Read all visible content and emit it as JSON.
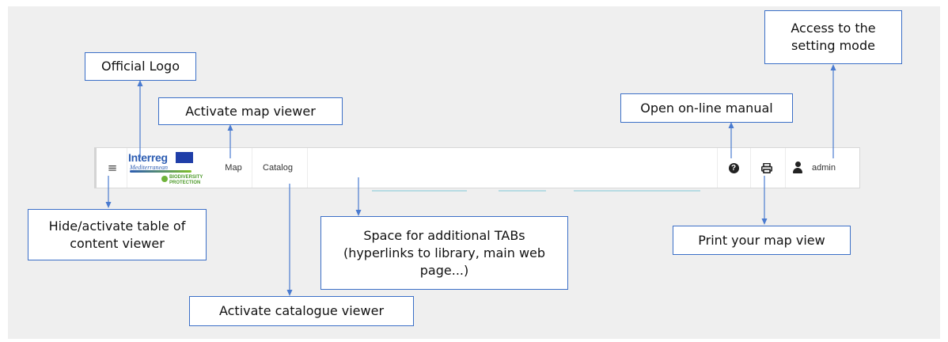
{
  "callouts": {
    "official_logo": "Official Logo",
    "activate_map": "Activate map viewer",
    "online_manual": "Open on-line manual",
    "setting_mode": "Access to the\nsetting mode",
    "hide_toc": "Hide/activate table of\ncontent viewer",
    "additional_tabs": "Space for additional TABs\n(hyperlinks to library, main web\npage...)",
    "print_view": "Print your map view",
    "catalogue": "Activate catalogue viewer"
  },
  "toolbar": {
    "menu_icon": "hamburger-icon",
    "logo": {
      "line1": "Interreg",
      "line2": "Mediterranean",
      "tagline": "BIODIVERSITY\nPROTECTION"
    },
    "tabs": [
      "Map",
      "Catalog"
    ],
    "help_icon": "question-circle-icon",
    "help_glyph": "?",
    "print_icon": "printer-icon",
    "user_icon": "user-icon",
    "user_name": "admin"
  },
  "colors": {
    "callout_border": "#3b6fc7",
    "arrow": "#4a7bd0",
    "logo_blue": "#2d5db2",
    "logo_green": "#6fb33a"
  }
}
